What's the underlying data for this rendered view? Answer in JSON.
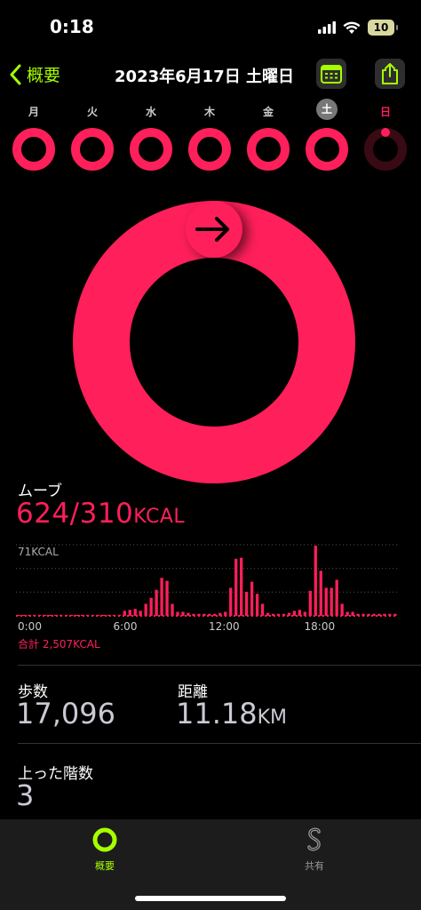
{
  "status": {
    "time": "0:18",
    "battery": "10"
  },
  "nav": {
    "back_label": "概要",
    "title": "2023年6月17日 土曜日"
  },
  "week": [
    {
      "label": "月",
      "state": "normal"
    },
    {
      "label": "火",
      "state": "normal"
    },
    {
      "label": "水",
      "state": "normal"
    },
    {
      "label": "木",
      "state": "normal"
    },
    {
      "label": "金",
      "state": "normal"
    },
    {
      "label": "土",
      "state": "selected"
    },
    {
      "label": "日",
      "state": "today"
    }
  ],
  "move": {
    "label": "ムーブ",
    "value": "624/310",
    "unit": "KCAL",
    "progress_percent": 201,
    "chart_max_label": "71KCAL",
    "ticks": [
      "0:00",
      "6:00",
      "12:00",
      "18:00"
    ],
    "total": "合計 2,507KCAL"
  },
  "chart_data": {
    "type": "bar",
    "x": [
      0,
      0.5,
      1,
      1.5,
      2,
      2.5,
      3,
      3.5,
      4,
      4.5,
      5,
      5.5,
      6,
      6.5,
      7,
      7.5,
      8,
      8.5,
      9,
      9.5,
      10,
      10.5,
      11,
      11.5,
      12,
      12.5,
      13,
      13.5,
      14,
      14.5,
      15,
      15.5,
      16,
      16.5,
      17,
      17.5,
      18,
      18.5,
      19,
      19.5,
      20,
      20.5,
      21,
      21.5,
      22,
      22.5,
      23,
      23.5
    ],
    "values": [
      1,
      1,
      1,
      1,
      1,
      1,
      1,
      1,
      1,
      1,
      1,
      1,
      1,
      1,
      1,
      1,
      1,
      1,
      1,
      1,
      5,
      6,
      7,
      5,
      12,
      18,
      26,
      38,
      35,
      12,
      4,
      4,
      3,
      2,
      2,
      2,
      2,
      2,
      3,
      4,
      28,
      57,
      58,
      24,
      34,
      22,
      12,
      3,
      2,
      2,
      2,
      3,
      5,
      6,
      4,
      25,
      70,
      45,
      28,
      28,
      36,
      12,
      4,
      4,
      2,
      2,
      2,
      2,
      2,
      2,
      2,
      2
    ],
    "ylim": [
      0,
      71
    ],
    "ylabel": "71KCAL"
  },
  "stats": {
    "steps_label": "歩数",
    "steps_value": "17,096",
    "distance_label": "距離",
    "distance_value": "11.18",
    "distance_unit": "KM",
    "floors_label": "上った階数",
    "floors_value": "3"
  },
  "tabs": [
    {
      "label": "概要",
      "active": true
    },
    {
      "label": "共有",
      "active": false
    }
  ],
  "colors": {
    "accent": "#a6ff00",
    "move": "#ff1f5a",
    "move_dark": "#3a0a14"
  }
}
